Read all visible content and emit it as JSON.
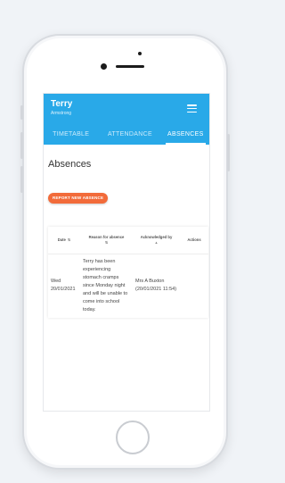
{
  "header": {
    "student_first_name": "Terry",
    "student_last_name": "Armstrong",
    "menu_icon": "hamburger-menu-icon",
    "background_color": "#29a9e8"
  },
  "tabs": [
    {
      "label": "TIMETABLE",
      "active": false
    },
    {
      "label": "ATTENDANCE",
      "active": false
    },
    {
      "label": "ABSENCES",
      "active": true
    }
  ],
  "page": {
    "title": "Absences",
    "report_button_label": "REPORT NEW ABSENCE",
    "report_button_color": "#f26b3a"
  },
  "table": {
    "columns": [
      {
        "label": "Date",
        "sort_icon": "sort-icon"
      },
      {
        "label": "Reason for absence",
        "sort_icon": "sort-icon"
      },
      {
        "label": "Acknowledged by",
        "sort_icon": "sort-arrow-up-icon"
      },
      {
        "label": "Actions",
        "sort_icon": ""
      }
    ],
    "rows": [
      {
        "date": "Wed 20/01/2021",
        "reason": "Terry has been experiencing stomach cramps since Monday night and will be unable to come into school today.",
        "acknowledged_by": "Mrs A Buxton (20/01/2021 11:54)",
        "actions": ""
      }
    ]
  }
}
